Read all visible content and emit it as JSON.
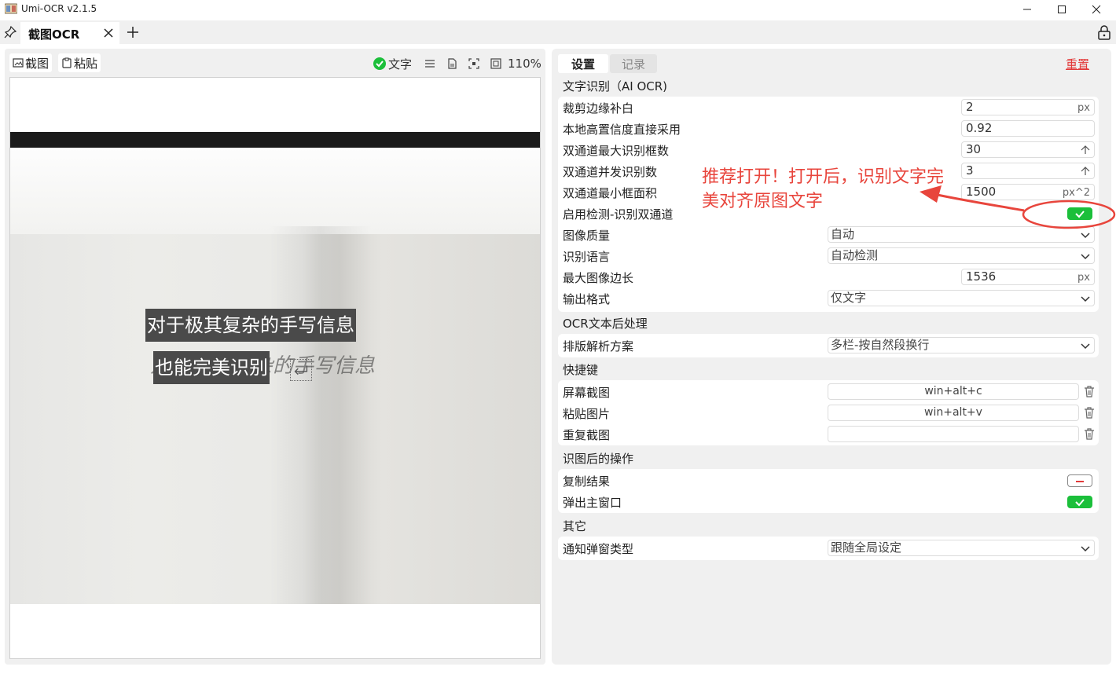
{
  "window": {
    "title": "Umi-OCR v2.1.5"
  },
  "tabs": [
    {
      "label": "截图OCR"
    }
  ],
  "left": {
    "screenshot_label": "截图",
    "paste_label": "粘贴",
    "text_toggle_label": "文字",
    "zoom": "110%",
    "ocr_lines": [
      "对于极其复杂的手写信息",
      "也能完美识别"
    ],
    "handwriting": "对于极其复杂的手写信息"
  },
  "right": {
    "tab_settings": "设置",
    "tab_records": "记录",
    "reset_label": "重置",
    "sections": {
      "ocr": "文字识别（AI OCR)",
      "postprocess": "OCR文本后处理",
      "hotkeys": "快捷键",
      "after": "识图后的操作",
      "other": "其它"
    },
    "ocr_rows": {
      "crop_padding": {
        "label": "裁剪边缘补白",
        "value": "2",
        "unit": "px"
      },
      "high_conf": {
        "label": "本地高置信度直接采用",
        "value": "0.92"
      },
      "max_boxes": {
        "label": "双通道最大识别框数",
        "value": "30"
      },
      "concurrency": {
        "label": "双通道并发识别数",
        "value": "3"
      },
      "min_area": {
        "label": "双通道最小框面积",
        "value": "1500",
        "unit": "px^2"
      },
      "dual_channel": {
        "label": "启用检测-识别双通道",
        "value": "on"
      },
      "image_quality": {
        "label": "图像质量",
        "value": "自动"
      },
      "language": {
        "label": "识别语言",
        "value": "自动检测"
      },
      "max_side": {
        "label": "最大图像边长",
        "value": "1536",
        "unit": "px"
      },
      "output_format": {
        "label": "输出格式",
        "value": "仅文字"
      }
    },
    "layout_row": {
      "label": "排版解析方案",
      "value": "多栏-按自然段换行"
    },
    "hotkey_rows": [
      {
        "label": "屏幕截图",
        "value": "win+alt+c"
      },
      {
        "label": "粘贴图片",
        "value": "win+alt+v"
      },
      {
        "label": "重复截图",
        "value": ""
      }
    ],
    "after_rows": {
      "copy": {
        "label": "复制结果",
        "value": "off"
      },
      "popup": {
        "label": "弹出主窗口",
        "value": "on"
      }
    },
    "notify_row": {
      "label": "通知弹窗类型",
      "value": "跟随全局设定"
    }
  },
  "annotation": {
    "line1": "推荐打开！打开后，识别文字完",
    "line2": "美对齐原图文字",
    "color": "#e8453c"
  },
  "colors": {
    "toggle_on": "#1bbf3a",
    "reset": "#e23a3a",
    "panel_bg": "#f0f0f0"
  }
}
